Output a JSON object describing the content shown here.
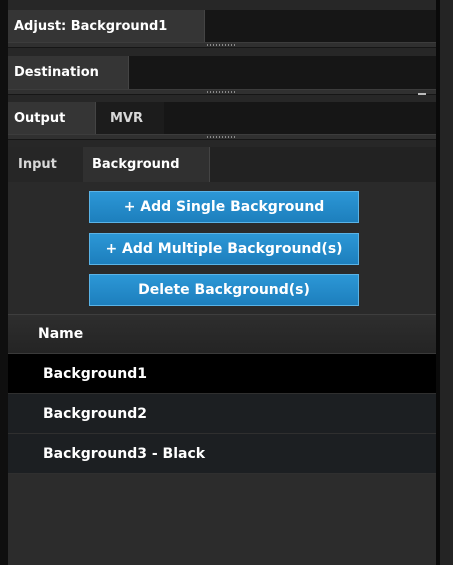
{
  "tabs": {
    "adjust": "Adjust: Background1",
    "destination": "Destination",
    "output": "Output",
    "mvr": "MVR",
    "input": "Input",
    "background": "Background"
  },
  "buttons": {
    "add_single": "+ Add Single Background",
    "add_multiple": "+ Add Multiple Background(s)",
    "delete": "Delete Background(s)"
  },
  "list": {
    "header": "Name",
    "rows": [
      "Background1",
      "Background2",
      "Background3 - Black"
    ]
  },
  "colors": {
    "accent_button": "#1f88c9",
    "selected_row": "#000000",
    "panel_bg": "#272727"
  }
}
